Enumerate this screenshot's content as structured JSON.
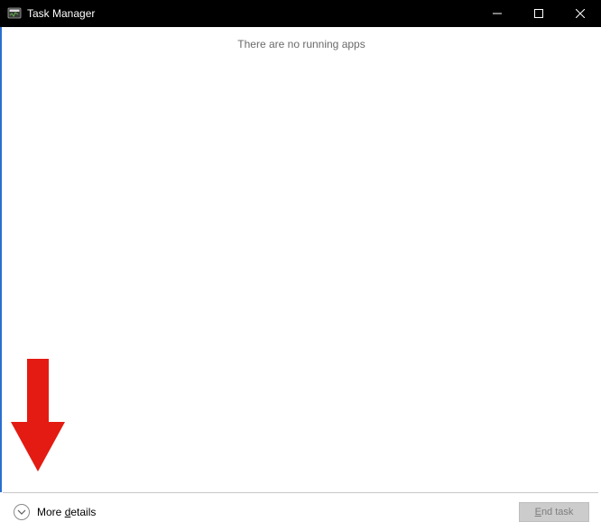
{
  "titlebar": {
    "title": "Task Manager"
  },
  "content": {
    "empty_message": "There are no running apps"
  },
  "footer": {
    "more_details_label": "More details",
    "end_task_label": "End task"
  }
}
